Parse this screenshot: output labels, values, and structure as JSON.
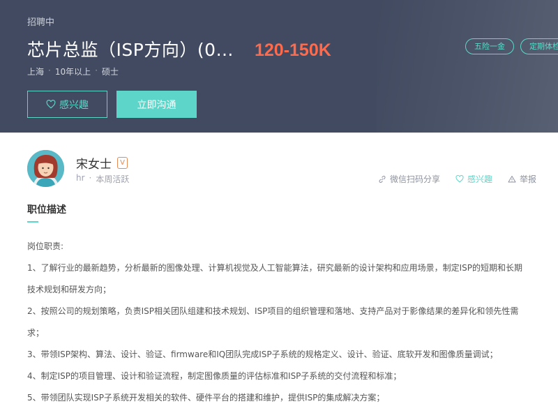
{
  "header": {
    "status": "招聘中",
    "job_title": "芯片总监（ISP方向）(0…",
    "salary": "120-150K",
    "meta": {
      "location": "上海",
      "experience": "10年以上",
      "degree": "硕士",
      "separator": "·"
    },
    "benefit_tags": [
      "五险一金",
      "定期体检"
    ],
    "interest_label": "感兴趣",
    "chat_label": "立即沟通"
  },
  "recruiter": {
    "name": "宋女士",
    "badge": "V",
    "role": "hr",
    "separator": "·",
    "activity": "本周活跃",
    "actions": {
      "share": "微信扫码分享",
      "interest": "感兴趣",
      "report": "举报"
    }
  },
  "description": {
    "section_title": "职位描述",
    "lines": [
      "岗位职责:",
      "1、了解行业的最新趋势，分析最新的图像处理、计算机视觉及人工智能算法，研究最新的设计架构和应用场景，制定ISP的短期和长期",
      "技术规划和研发方向；",
      "2、按照公司的规划策略，负责ISP相关团队组建和技术规划、ISP项目的组织管理和落地、支持产品对于影像结果的差异化和领先性需",
      "求；",
      "3、带领ISP架构、算法、设计、验证、firmware和IQ团队完成ISP子系统的规格定义、设计、验证、底软开发和图像质量调试；",
      "4、制定ISP的项目管理、设计和验证流程，制定图像质量的评估标准和ISP子系统的交付流程和标准；",
      "5、带领团队实现ISP子系统开发相关的软件、硬件平台的搭建和维护，提供ISP的集成解决方案；"
    ]
  },
  "colors": {
    "hero_bg": "#414a60",
    "accent": "#5dd5c8",
    "salary": "#fe6a4c"
  },
  "icons": {
    "interest": "heart-outline-icon",
    "share": "link-icon",
    "report": "warning-triangle-icon",
    "verified": "verified-badge-icon"
  }
}
